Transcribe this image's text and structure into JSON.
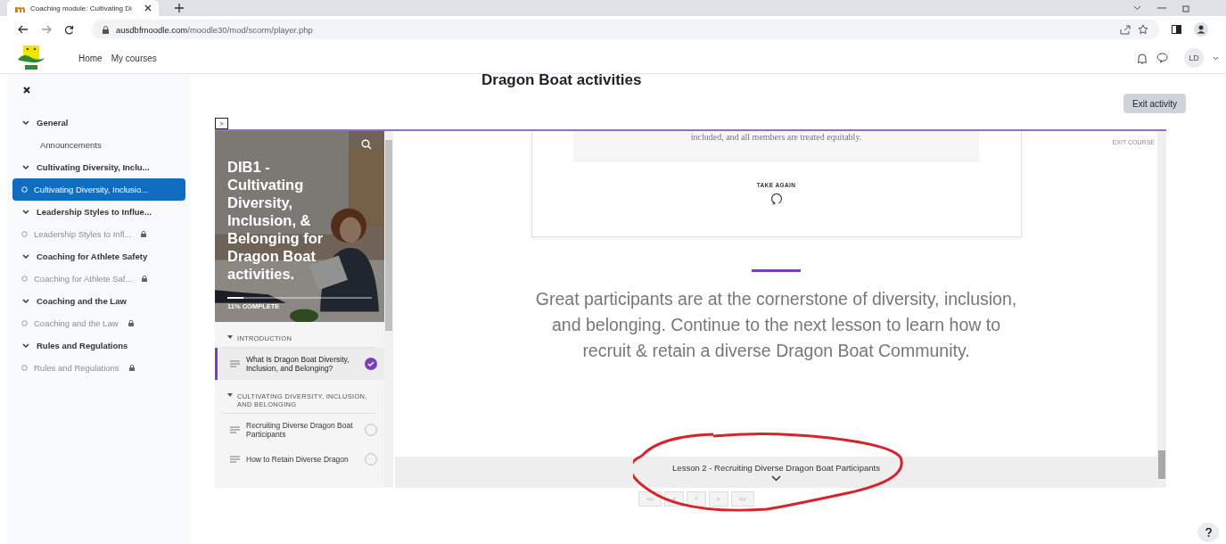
{
  "browser": {
    "tab_title": "Coaching module: Cultivating Di",
    "url_host": "ausdbfmoodle.com",
    "url_path": "/moodle30/mod/scorm/player.php"
  },
  "navbar": {
    "links": [
      "Home",
      "My courses"
    ],
    "avatar": "LD"
  },
  "sidebar": {
    "sections": [
      {
        "title": "General",
        "expanded": true,
        "items": [
          {
            "label": "Announcements",
            "kind": "forum",
            "selected": false,
            "locked": false
          }
        ]
      },
      {
        "title": "Cultivating Diversity, Inclu...",
        "expanded": true,
        "items": [
          {
            "label": "Cultivating Diversity, Inclusio...",
            "kind": "scorm",
            "selected": true,
            "locked": false
          }
        ]
      },
      {
        "title": "Leadership Styles to Influe...",
        "expanded": true,
        "items": [
          {
            "label": "Leadership Styles to Infl...",
            "kind": "scorm",
            "selected": false,
            "locked": true
          }
        ]
      },
      {
        "title": "Coaching for Athlete Safety",
        "expanded": true,
        "items": [
          {
            "label": "Coaching for Athlete Saf...",
            "kind": "scorm",
            "selected": false,
            "locked": true
          }
        ]
      },
      {
        "title": "Coaching and the Law",
        "expanded": true,
        "items": [
          {
            "label": "Coaching and the Law",
            "kind": "scorm",
            "selected": false,
            "locked": true
          }
        ]
      },
      {
        "title": "Rules and Regulations",
        "expanded": true,
        "items": [
          {
            "label": "Rules and Regulations",
            "kind": "scorm",
            "selected": false,
            "locked": true
          }
        ]
      }
    ]
  },
  "page": {
    "title": "Dragon Boat activities",
    "exit_button": "Exit activity",
    "toggle": ">"
  },
  "toc": {
    "course_title": "DIB1 - Cultivating Diversity, Inclusion, & Belonging for Dragon Boat activities.",
    "progress": {
      "label": "11% COMPLETE",
      "level": 0.11
    },
    "sections": [
      {
        "title": "INTRODUCTION",
        "expanded": true,
        "lessons": [
          {
            "title": "What Is Dragon Boat Diversity, Inclusion, and Belonging?",
            "selected": true,
            "completed": true
          }
        ]
      },
      {
        "title": "CULTIVATING DIVERSITY, INCLUSION, AND BELONGING",
        "expanded": true,
        "lessons": [
          {
            "title": "Recruiting Diverse Dragon Boat Participants",
            "selected": false,
            "completed": false
          },
          {
            "title": "How to Retain Diverse Dragon",
            "selected": false,
            "completed": false
          }
        ]
      }
    ]
  },
  "content": {
    "exit_course": "EXIT COURSE",
    "feedback_text": "included, and all members are treated equitably.",
    "take_again": "TAKE AGAIN",
    "closing_text": "Great participants are at the cornerstone of diversity, inclusion, and belonging. Continue to the next lesson to learn how to recruit & retain a diverse Dragon Boat Community.",
    "next_lesson": "Lesson 2 - Recruiting Diverse Dragon Boat Participants"
  },
  "pager": [
    "<<",
    "<",
    "^",
    ">",
    ">>"
  ]
}
